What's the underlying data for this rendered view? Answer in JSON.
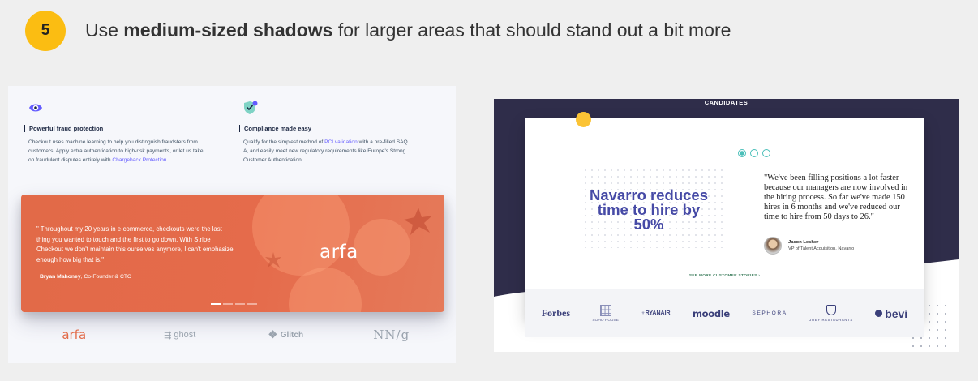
{
  "header": {
    "number": "5",
    "text_before": "Use ",
    "text_bold": "medium-sized shadows",
    "text_after": " for larger areas that should stand out a bit more"
  },
  "left": {
    "feature1": {
      "title": "Powerful fraud protection",
      "body": "Checkout uses machine learning to help you distinguish fraudsters from customers. Apply extra authentication to high-risk payments, or let us take on fraudulent disputes entirely with ",
      "link": "Chargeback Protection",
      "body_end": "."
    },
    "feature2": {
      "title": "Compliance made easy",
      "body_start": "Qualify for the simplest method of ",
      "link": "PCI validation",
      "body_end": " with a pre-filled SAQ A, and easily meet new regulatory requirements like Europe's Strong Customer Authentication."
    },
    "quote": "\" Throughout my 20 years in e-commerce, checkouts were the last thing you wanted to touch and the first to go down. With Stripe Checkout we don't maintain this ourselves anymore, I can't emphasize enough how big that is.\"",
    "author_name": "Bryan Mahoney",
    "author_role": ", Co-Founder & CTO",
    "card_logo": "arfa",
    "logos": [
      "arfa",
      "ghost",
      "Glitch",
      "NN/g"
    ]
  },
  "right": {
    "top_label": "CANDIDATES",
    "headline": "Navarro reduces time to hire by 50%",
    "quote": "\"We've been filling positions a lot faster because our managers are now involved in the hiring process. So far we've made 150 hires in 6 months and we've reduced our time to hire from 50 days to 26.\"",
    "person_name": "Jason Lesher",
    "person_title": "VP of Talent Acquisition, Navarro",
    "see_more": "SEE MORE CUSTOMER STORIES  ›",
    "logos": {
      "forbes": "Forbes",
      "soho": "SOHO HOUSE",
      "ryanair": "RYANAIR",
      "moodle": "moodle",
      "sephora": "SEPHORA",
      "joey": "JOEY RESTAURANTS",
      "bevi": "bevi"
    }
  },
  "colors": {
    "badge": "#fbbd12",
    "stripe_purple": "#635bff",
    "arfa_orange": "#e26a48",
    "navy": "#2f2d4a",
    "navarro_purple": "#464aa6",
    "teal": "#4bbfb9"
  }
}
